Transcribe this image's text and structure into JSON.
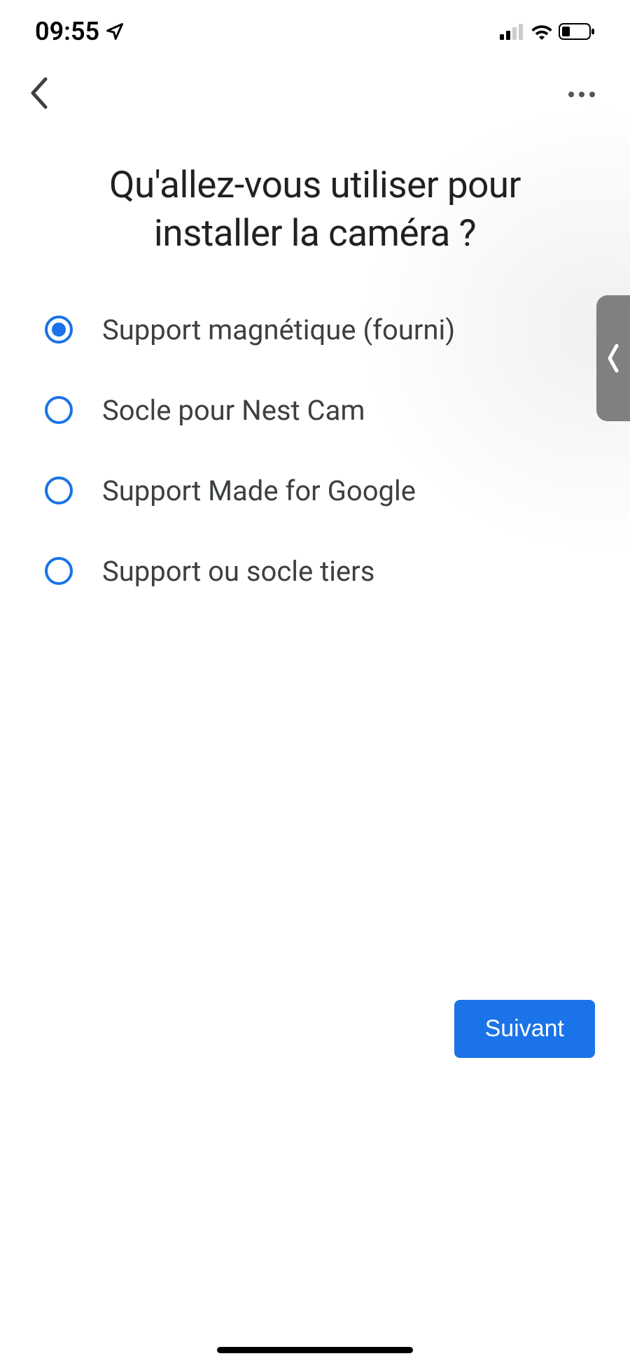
{
  "status": {
    "time": "09:55"
  },
  "content": {
    "title": "Qu'allez-vous utiliser pour installer la caméra ?",
    "options": [
      {
        "label": "Support magnétique (fourni)",
        "selected": true
      },
      {
        "label": "Socle pour Nest Cam",
        "selected": false
      },
      {
        "label": "Support Made for Google",
        "selected": false
      },
      {
        "label": "Support ou socle tiers",
        "selected": false
      }
    ]
  },
  "footer": {
    "next_label": "Suivant"
  }
}
